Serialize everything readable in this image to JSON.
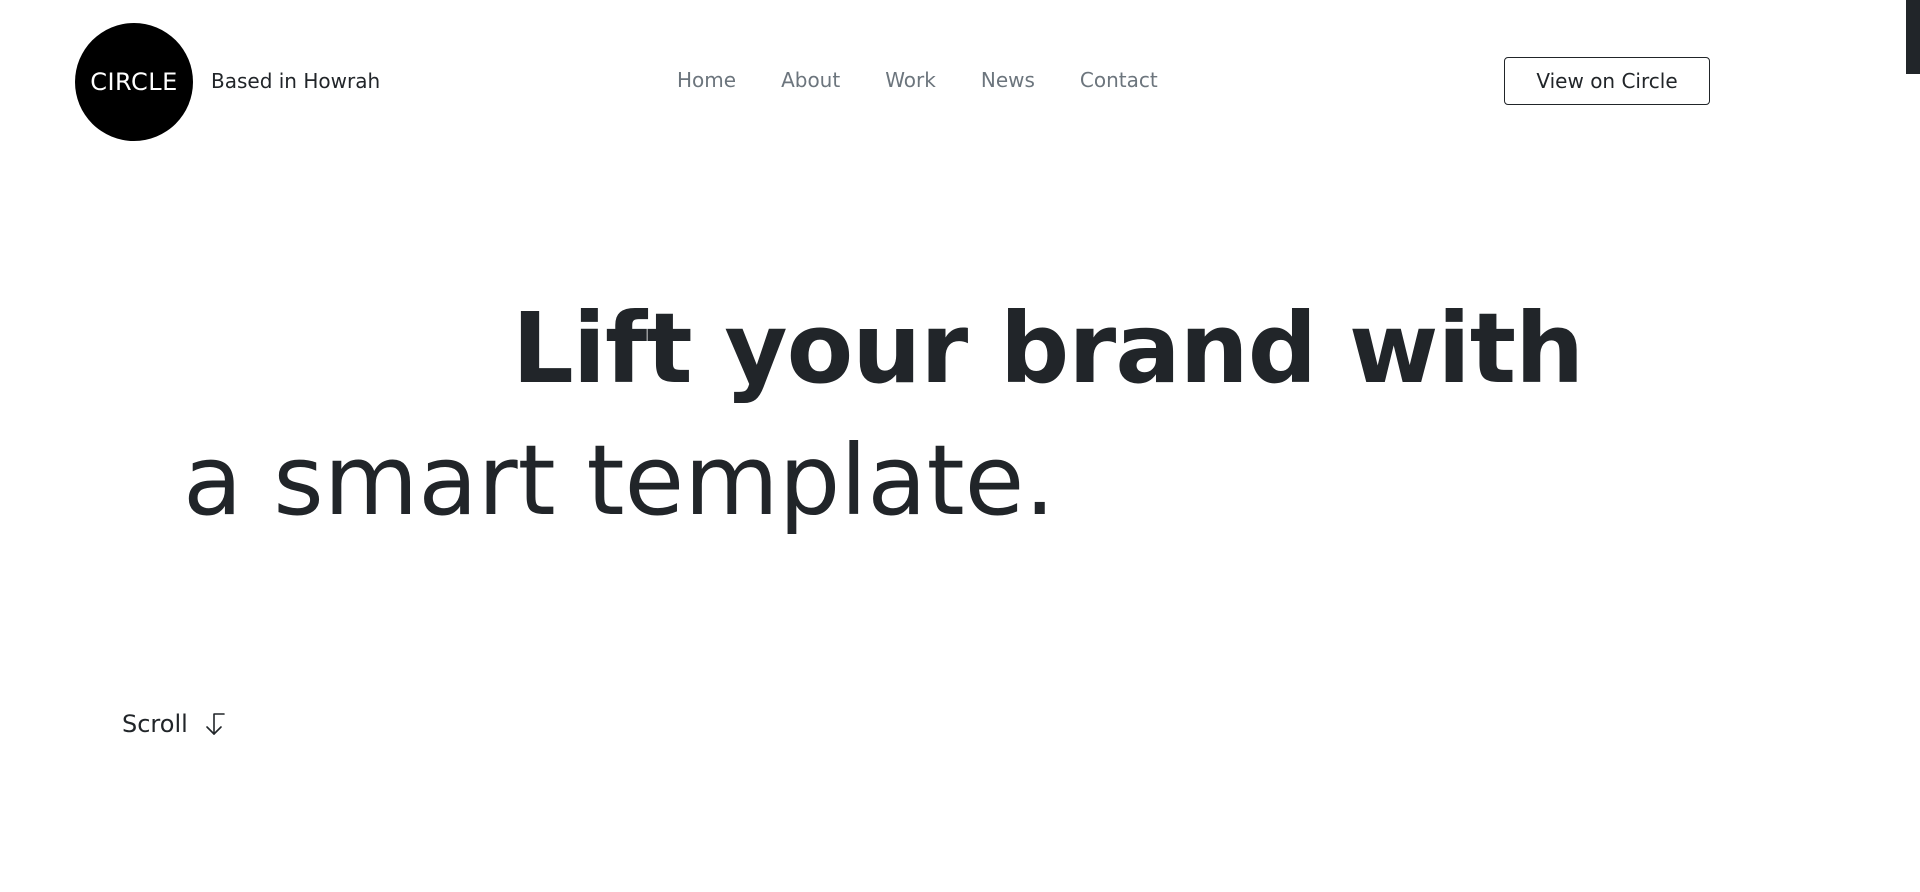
{
  "header": {
    "logo_text": "CIRCLE",
    "location": "Based in Howrah",
    "nav": [
      {
        "label": "Home"
      },
      {
        "label": "About"
      },
      {
        "label": "Work"
      },
      {
        "label": "News"
      },
      {
        "label": "Contact"
      }
    ],
    "cta_label": "View on Circle"
  },
  "hero": {
    "line1": "Lift your brand with",
    "line2": "a smart template."
  },
  "scroll": {
    "label": "Scroll",
    "icon": "arrow-down-turn-icon"
  },
  "colors": {
    "text": "#212529",
    "nav_text": "#6c757d",
    "logo_bg": "#000000",
    "background": "#ffffff"
  }
}
